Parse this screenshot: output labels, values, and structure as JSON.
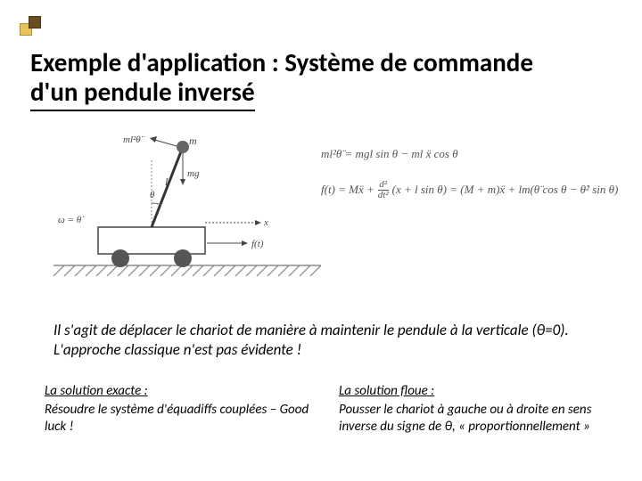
{
  "title_line1": "Exemple d'application : Système de commande",
  "title_line2": "d'un pendule inversé",
  "equation1": "ml²θ̈ = mgl sin θ − ml ẍ cos θ",
  "equation2_lhs": "f(t) = Mẍ +",
  "equation2_frac_top": "d²",
  "equation2_frac_bot": "dt²",
  "equation2_rhs": "(x + l sin θ) = (M + m)ẍ + lm(θ̈ cos θ − θ̇² sin θ)",
  "diagram": {
    "label_m": "m",
    "label_ml2": "ml²θ̈",
    "label_l": "l",
    "label_theta": "θ",
    "label_mg": "mg",
    "label_x": "x",
    "label_omega": "ω = θ̇",
    "label_f": "f(t)"
  },
  "intro": "Il s'agit de déplacer le chariot de manière à maintenir le pendule à la verticale (θ=0). L'approche classique n'est pas évidente !",
  "col_exact_heading": "La solution exacte :",
  "col_exact_body": "Résoudre le système d'équadiffs couplées – Good luck !",
  "col_fuzzy_heading": "La solution floue :",
  "col_fuzzy_body": "Pousser le chariot à gauche ou à droite en sens inverse du signe de θ, « proportionnellement »"
}
